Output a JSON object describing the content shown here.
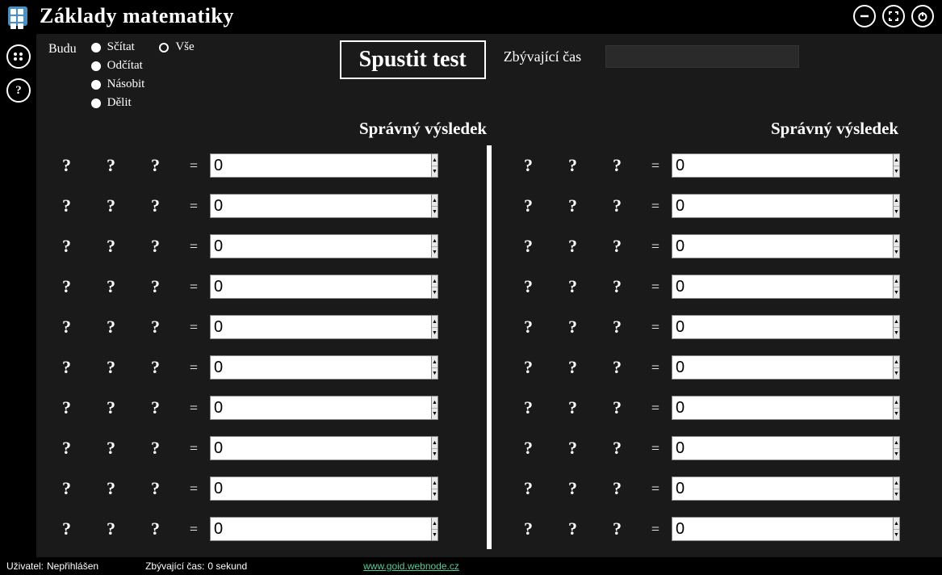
{
  "app": {
    "title": "Základy matematiky"
  },
  "ops": {
    "budu": "Budu",
    "items": [
      "Sčítat",
      "Odčítat",
      "Násobit",
      "Dělit"
    ],
    "all": "Vše"
  },
  "start_button": "Spustit test",
  "time_label": "Zbývající čas",
  "result_header": "Správný výsledek",
  "placeholder": "?",
  "equals": "=",
  "input_default": "0",
  "rows_per_col": 10,
  "footer": {
    "user_label": "Uživatel:",
    "user_value": "Nepřihlášen",
    "time_label": "Zbývající čas:",
    "time_value": "0 sekund",
    "link": "www.goid.webnode.cz"
  }
}
